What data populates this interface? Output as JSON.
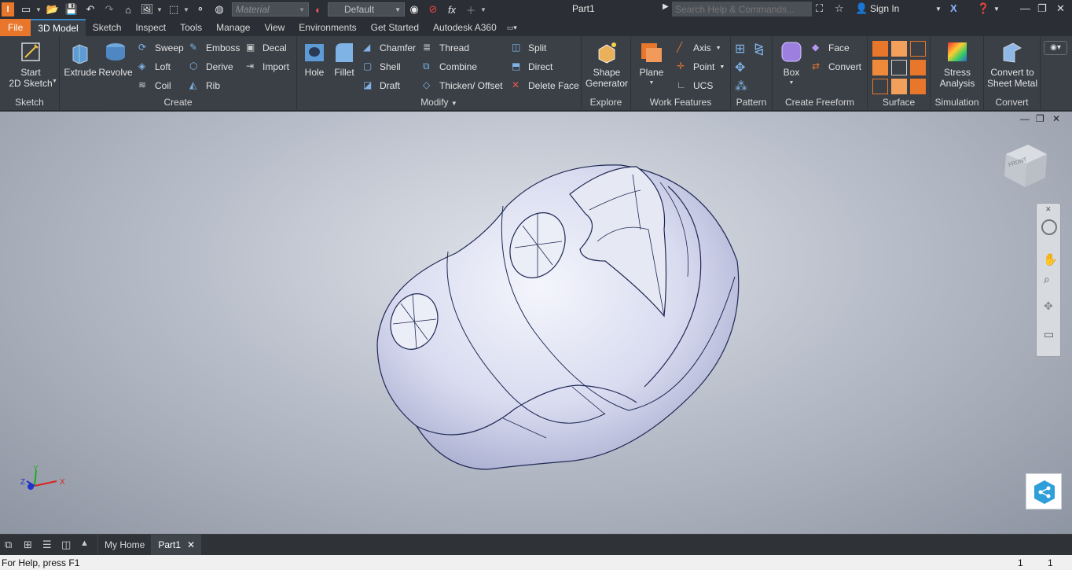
{
  "titlebar": {
    "material_placeholder": "Material",
    "appearance_value": "Default",
    "document_title": "Part1",
    "search_placeholder": "Search Help & Commands...",
    "sign_in": "Sign In"
  },
  "tabs": [
    "File",
    "3D Model",
    "Sketch",
    "Inspect",
    "Tools",
    "Manage",
    "View",
    "Environments",
    "Get Started",
    "Autodesk A360"
  ],
  "ribbon": {
    "sketch": {
      "label": "Sketch",
      "start_line1": "Start",
      "start_line2": "2D Sketch"
    },
    "create": {
      "label": "Create",
      "extrude": "Extrude",
      "revolve": "Revolve",
      "sweep": "Sweep",
      "loft": "Loft",
      "coil": "Coil",
      "emboss": "Emboss",
      "derive": "Derive",
      "rib": "Rib",
      "decal": "Decal",
      "import": "Import"
    },
    "modify": {
      "label": "Modify",
      "hole": "Hole",
      "fillet": "Fillet",
      "chamfer": "Chamfer",
      "shell": "Shell",
      "draft": "Draft",
      "thread": "Thread",
      "combine": "Combine",
      "thicken": "Thicken/ Offset",
      "split": "Split",
      "direct": "Direct",
      "delete_face": "Delete Face"
    },
    "explore": {
      "label": "Explore",
      "shape_line1": "Shape",
      "shape_line2": "Generator"
    },
    "work_features": {
      "label": "Work Features",
      "plane": "Plane",
      "axis": "Axis",
      "point": "Point",
      "ucs": "UCS"
    },
    "pattern": {
      "label": "Pattern"
    },
    "freeform": {
      "label": "Create Freeform",
      "box": "Box",
      "face": "Face",
      "convert": "Convert"
    },
    "surface": {
      "label": "Surface"
    },
    "simulation": {
      "label": "Simulation",
      "stress_line1": "Stress",
      "stress_line2": "Analysis"
    },
    "convert": {
      "label": "Convert",
      "sheet_line1": "Convert to",
      "sheet_line2": "Sheet Metal"
    }
  },
  "viewcube": {
    "face_label": "FRONT"
  },
  "axes": {
    "x": "X",
    "y": "Y",
    "z": "Z"
  },
  "doctabs": {
    "home": "My Home",
    "part": "Part1"
  },
  "status": {
    "help": "For Help, press F1",
    "count1": "1",
    "count2": "1"
  },
  "colors": {
    "file_tab": "#e8762b",
    "ribbon_bg": "#3b4047",
    "model_fill": "#d9dcf0",
    "model_edge": "#1f2a55"
  }
}
